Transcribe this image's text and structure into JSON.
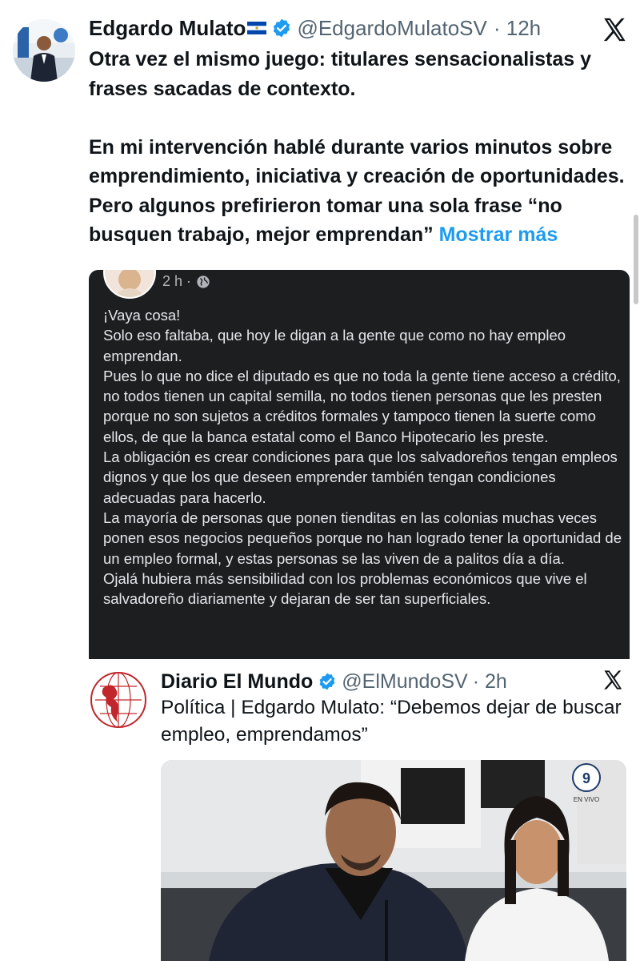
{
  "tweet": {
    "author_name": "Edgardo Mulato",
    "handle": "@EdgardoMulatoSV",
    "time": "· 12h",
    "text": "Otra vez el mismo juego: titulares sensacionalistas y frases sacadas de contexto.\n\nEn mi intervención hablé durante varios minutos sobre emprendimiento, iniciativa y creación de oportunidades. Pero algunos prefirieron tomar una sola frase  “no busquen trabajo, mejor emprendan” ",
    "show_more": "Mostrar más"
  },
  "quoted_post": {
    "time": "2 h ·",
    "body": "¡Vaya cosa!\nSolo eso faltaba, que hoy le digan a la gente que como no hay empleo emprendan.\nPues lo que no dice el diputado es que no toda la gente tiene acceso a crédito, no todos tienen un capital semilla, no todos tienen personas que les presten porque no son sujetos a créditos formales y tampoco tienen la suerte como ellos, de que la banca estatal como el Banco Hipotecario les preste.\nLa obligación es crear condiciones para que los salvadoreños tengan empleos dignos y que los que deseen emprender también tengan condiciones adecuadas para hacerlo.\nLa mayoría de personas que ponen tienditas en las colonias muchas veces ponen esos negocios pequeños  porque no han logrado tener la oportunidad de un empleo formal, y estas personas se las viven de a palitos día a día.\nOjalá hubiera más sensibilidad con los problemas económicos que vive el salvadoreño diariamente y dejaran de ser tan superficiales."
  },
  "news_post": {
    "name": "Diario El Mundo",
    "handle": "@ElMundoSV",
    "time": "· 2h",
    "headline": "Política | Edgardo Mulato: “Debemos dejar de buscar empleo, emprendamos”",
    "photo_badge": "9",
    "photo_badge_sub": "EN VIVO"
  },
  "icons": {
    "verified": "verified-badge-icon",
    "flag": "el-salvador-flag-icon",
    "x": "x-logo-icon",
    "globe": "globe-icon"
  },
  "colors": {
    "link": "#1d9bf0",
    "verified": "#1d9bf0",
    "dark_card": "#1d1e20",
    "secondary_text": "#536471"
  }
}
